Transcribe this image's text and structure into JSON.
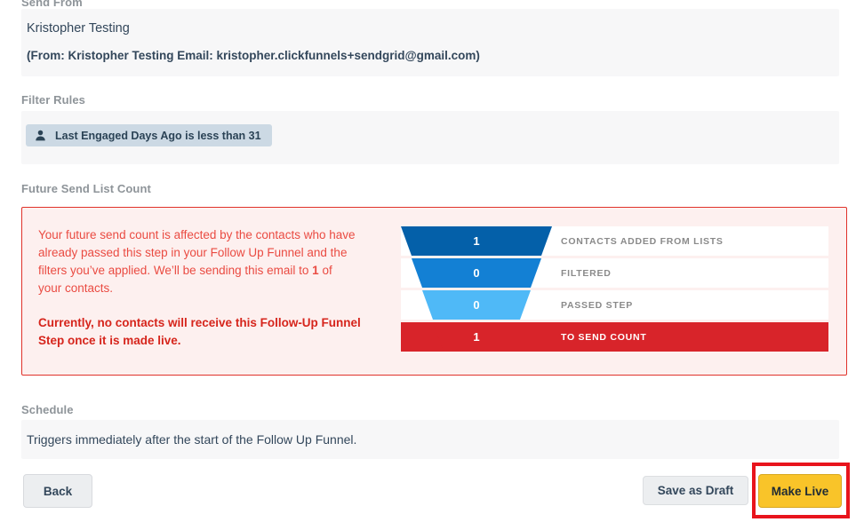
{
  "sections": {
    "send_from": {
      "label": "Send From",
      "name": "Kristopher Testing",
      "from_line": "(From: Kristopher Testing Email: kristopher.clickfunnels+sendgrid@gmail.com)"
    },
    "filter_rules": {
      "label": "Filter Rules",
      "chip_icon": "person-icon",
      "chip_text": "Last Engaged Days Ago is less than 31"
    },
    "future_send_list_count": {
      "label": "Future Send List Count",
      "alert_paragraph_part1": "Your future send count is affected by the contacts who have already passed this step in your Follow Up Funnel and the filters you’ve applied. We’ll be sending this email to ",
      "alert_paragraph_count": "1",
      "alert_paragraph_part2": " of your contacts.",
      "alert_strong": "Currently, no contacts will receive this Follow-Up Funnel Step once it is made live."
    },
    "schedule": {
      "label": "Schedule",
      "text": "Triggers immediately after the start of the Follow Up Funnel."
    }
  },
  "footer": {
    "back_label": "Back",
    "save_draft_label": "Save as Draft",
    "make_live_label": "Make Live"
  },
  "colors": {
    "alert_border": "#e0322a",
    "alert_bg": "#fdf0ef",
    "alert_text": "#ea4b42",
    "alert_strong": "#d6251c",
    "make_live": "#f9c429",
    "highlight": "#e8141c",
    "panel_bg": "#f7f7f8",
    "chip_bg": "#ccd9e4"
  },
  "chart_data": {
    "type": "bar",
    "title": "Future Send List Count",
    "categories": [
      "CONTACTS ADDED FROM LISTS",
      "FILTERED",
      "PASSED STEP",
      "TO SEND COUNT"
    ],
    "values": [
      1,
      0,
      0,
      1
    ],
    "value_labels": [
      "1",
      "0",
      "0",
      "1"
    ],
    "colors": [
      "#0460a9",
      "#1380d4",
      "#4fb9f7",
      "#d8242a"
    ],
    "xlabel": "",
    "ylabel": "",
    "legend": "none",
    "grid": false
  }
}
